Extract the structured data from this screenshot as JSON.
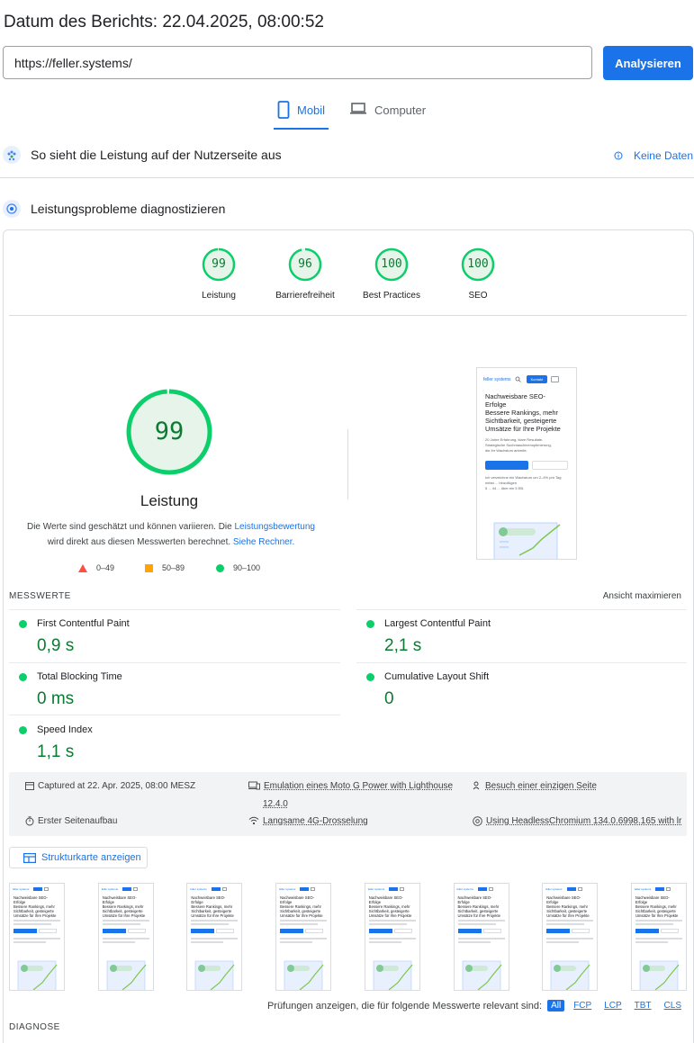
{
  "header": {
    "report_date": "Datum des Berichts: 22.04.2025, 08:00:52",
    "url_value": "https://feller.systems/",
    "analyze_label": "Analysieren"
  },
  "tabs": [
    {
      "label": "Mobil",
      "active": true,
      "icon": "smartphone-icon"
    },
    {
      "label": "Computer",
      "active": false,
      "icon": "laptop-icon"
    }
  ],
  "field_section": {
    "title": "So sieht die Leistung auf der Nutzerseite aus",
    "no_data": "Keine Daten",
    "icon": "users-icon"
  },
  "lab_section": {
    "title": "Leistungsprobleme diagnostizieren",
    "icon": "diagnose-icon"
  },
  "categories": [
    {
      "score": "99",
      "label": "Leistung",
      "fraction": 0.99
    },
    {
      "score": "96",
      "label": "Barrierefreiheit",
      "fraction": 0.96
    },
    {
      "score": "100",
      "label": "Best Practices",
      "fraction": 1.0
    },
    {
      "score": "100",
      "label": "SEO",
      "fraction": 1.0
    }
  ],
  "performance": {
    "score": "99",
    "fraction": 0.99,
    "title": "Leistung",
    "desc_part1": "Die Werte sind geschätzt und können variieren. Die ",
    "desc_link1": "Leistungsbewertung",
    "desc_part2": "wird direkt aus diesen Messwerten berechnet. ",
    "desc_link2": "Siehe Rechner.",
    "legend": [
      {
        "range": "0–49",
        "color": "#ff4e42",
        "shape": "triangle"
      },
      {
        "range": "50–89",
        "color": "#ffa400",
        "shape": "square"
      },
      {
        "range": "90–100",
        "color": "#0cce6b",
        "shape": "circle"
      }
    ]
  },
  "screenshot": {
    "logo": "feller systems",
    "button": "Kontakt",
    "headline1": "Nachweisbare SEO-",
    "headline2": "Erfolge",
    "headline3": "Bessere Rankings, mehr",
    "headline4": "Sichtbarkeit, gesteigerte",
    "headline5": "Umsätze für Ihre Projekte",
    "text1": "20 Jahre Erfahrung, klare Resultate.",
    "text2": "Strategische Suchmaschinenoptimierung,",
    "text3": "die Ihr Wachstum antreibt.",
    "cta1": "SEO-Beratung vereinbaren",
    "cta2": "Kontakt aufnehmen",
    "small1": "Ich verzeichne ein Wachstum um 2–4% pro Tag",
    "small2": "nebst ... hinzufügen",
    "small3": "5 ... 44 ... über ein 5 EB."
  },
  "metrics": {
    "label": "MESSWERTE",
    "maximize": "Ansicht maximieren",
    "items": [
      {
        "name": "First Contentful Paint",
        "value": "0,9 s"
      },
      {
        "name": "Largest Contentful Paint",
        "value": "2,1 s"
      },
      {
        "name": "Total Blocking Time",
        "value": "0 ms"
      },
      {
        "name": "Cumulative Layout Shift",
        "value": "0"
      },
      {
        "name": "Speed Index",
        "value": "1,1 s"
      }
    ]
  },
  "run_info": {
    "captured": "Captured at 22. Apr. 2025, 08:00 MESZ",
    "emulation": "Emulation eines Moto G Power with Lighthouse",
    "emulation_version": "12.4.0",
    "session": "Besuch einer einzigen Seite",
    "load": "Erster Seitenaufbau",
    "throttling": "Langsame 4G-Drosselung",
    "browser": "Using HeadlessChromium 134.0.6998.165 with lr"
  },
  "treemap_label": "Strukturkarte anzeigen",
  "thumbnails_count": 8,
  "filter": {
    "prompt": "Prüfungen anzeigen, die für folgende Messwerte relevant sind:",
    "chips": [
      "All",
      "FCP",
      "LCP",
      "TBT",
      "CLS"
    ]
  },
  "diagnose_label": "DIAGNOSE"
}
